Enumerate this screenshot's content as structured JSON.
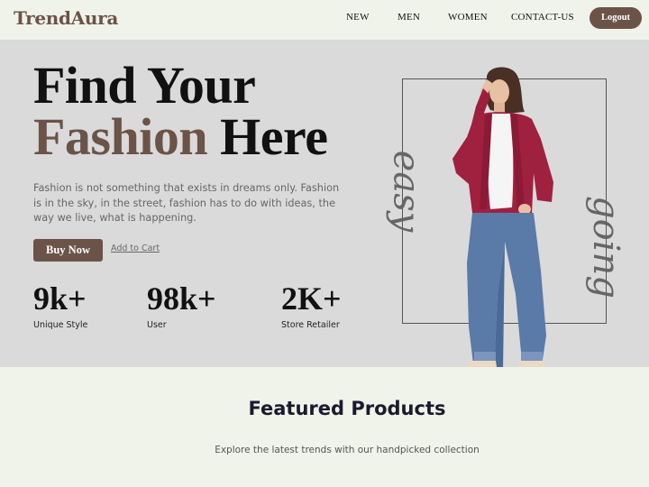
{
  "brand": {
    "name": "TrendAura"
  },
  "nav": {
    "links": [
      "NEW",
      "MEN",
      "WOMEN",
      "CONTACT-US"
    ],
    "logout_label": "Logout"
  },
  "hero": {
    "headline_line1": "Find Your",
    "headline_accent": "Fashion",
    "headline_rest": "Here",
    "description": "Fashion is not something that exists in dreams only. Fashion is in the sky, in the street, fashion has to do with ideas, the way we live, what is happening.",
    "buy_label": "Buy Now",
    "cart_label": "Add to Cart",
    "stats": [
      {
        "value": "9k+",
        "label": "Unique Style"
      },
      {
        "value": "98k+",
        "label": "User"
      },
      {
        "value": "2K+",
        "label": "Store Retailer"
      }
    ],
    "script_left": "easy",
    "script_right": "going"
  },
  "featured": {
    "title": "Featured Products",
    "subtitle": "Explore the latest trends with our handpicked collection"
  },
  "colors": {
    "brand": "#6b5348",
    "page_bg": "#f0f3e9",
    "hero_bg": "#dadada",
    "jacket": "#a0203f",
    "jeans": "#5a7aa8"
  },
  "images": {
    "hero_model": "woman in red cardigan, white tee and blue jeans"
  }
}
